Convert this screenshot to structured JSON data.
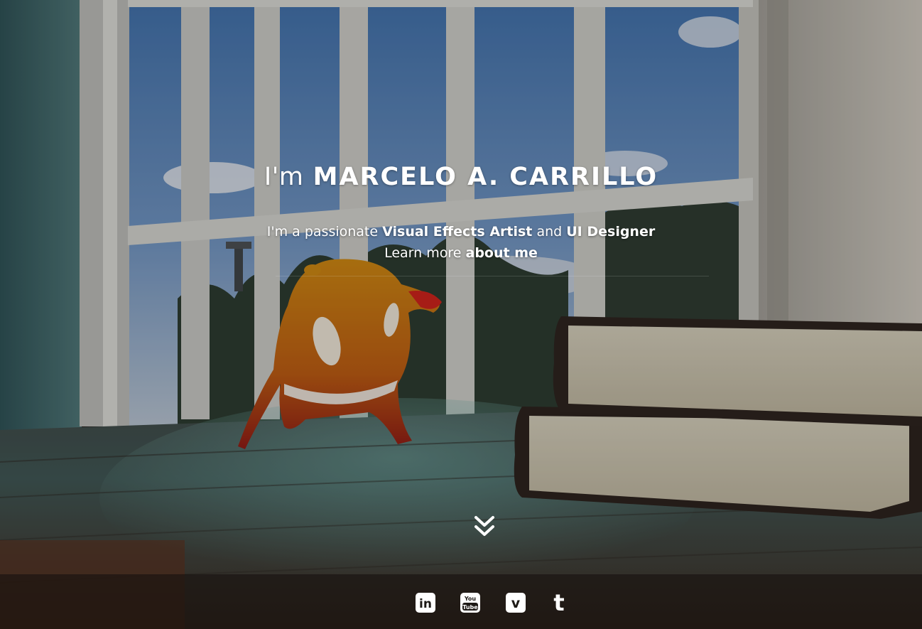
{
  "hero": {
    "greeting_prefix": "I'm",
    "name": "MARCELO A. CARRILLO",
    "tagline_start": "I'm a passionate",
    "role_1": "Visual Effects Artist",
    "tagline_and": "and",
    "role_2": "UI Designer",
    "learn_more_prefix": "Learn more",
    "about_link": "about me"
  },
  "scroll_down": {
    "icon": "double-chevron-down-icon"
  },
  "social_links": [
    {
      "name": "linkedin",
      "icon": "linkedin-icon",
      "glyph": "in"
    },
    {
      "name": "youtube",
      "icon": "youtube-icon",
      "glyph_top": "You",
      "glyph_bottom": "Tube"
    },
    {
      "name": "vimeo",
      "icon": "vimeo-icon",
      "glyph": "v"
    },
    {
      "name": "tumblr",
      "icon": "tumblr-icon",
      "glyph": "t"
    }
  ],
  "colors": {
    "text": "#ffffff",
    "footer_bg": "#16120f"
  }
}
